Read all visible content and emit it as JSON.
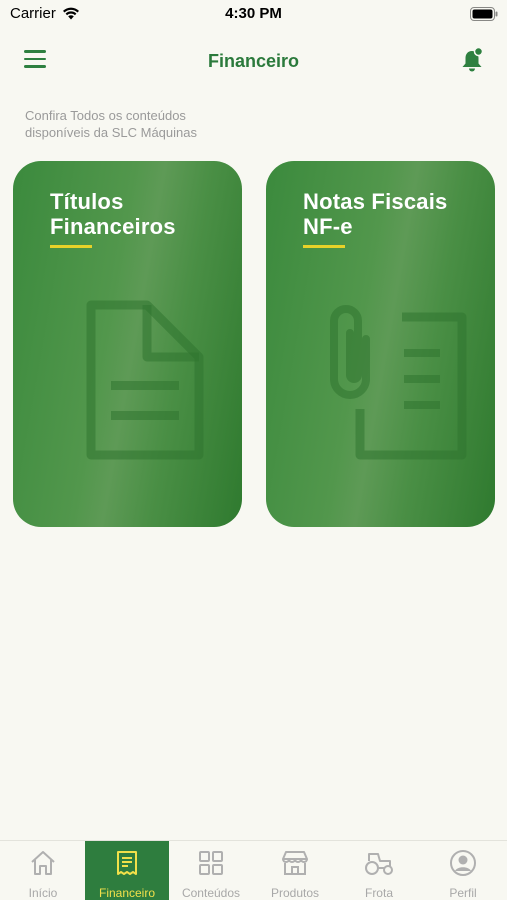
{
  "status_bar": {
    "carrier": "Carrier",
    "time": "4:30 PM"
  },
  "header": {
    "title": "Financeiro",
    "menu_icon": "hamburger-menu-icon",
    "notification_icon": "bell-icon"
  },
  "subtitle": "Confira Todos os conteúdos disponíveis da SLC Máquinas",
  "cards": [
    {
      "title_line1": "Títulos",
      "title_line2": "Financeiros",
      "icon": "document-icon"
    },
    {
      "title_line1": "Notas Fiscais",
      "title_line2": "NF-e",
      "icon": "paperclip-document-icon"
    }
  ],
  "tabs": [
    {
      "label": "Início",
      "icon": "home-icon",
      "active": false
    },
    {
      "label": "Financeiro",
      "icon": "receipt-icon",
      "active": true
    },
    {
      "label": "Conteúdos",
      "icon": "grid-icon",
      "active": false
    },
    {
      "label": "Produtos",
      "icon": "store-icon",
      "active": false
    },
    {
      "label": "Frota",
      "icon": "tractor-icon",
      "active": false
    },
    {
      "label": "Perfil",
      "icon": "user-icon",
      "active": false
    }
  ],
  "colors": {
    "brand_green": "#2e7d3e",
    "accent_yellow": "#e7d229",
    "background": "#f8f8f2"
  }
}
